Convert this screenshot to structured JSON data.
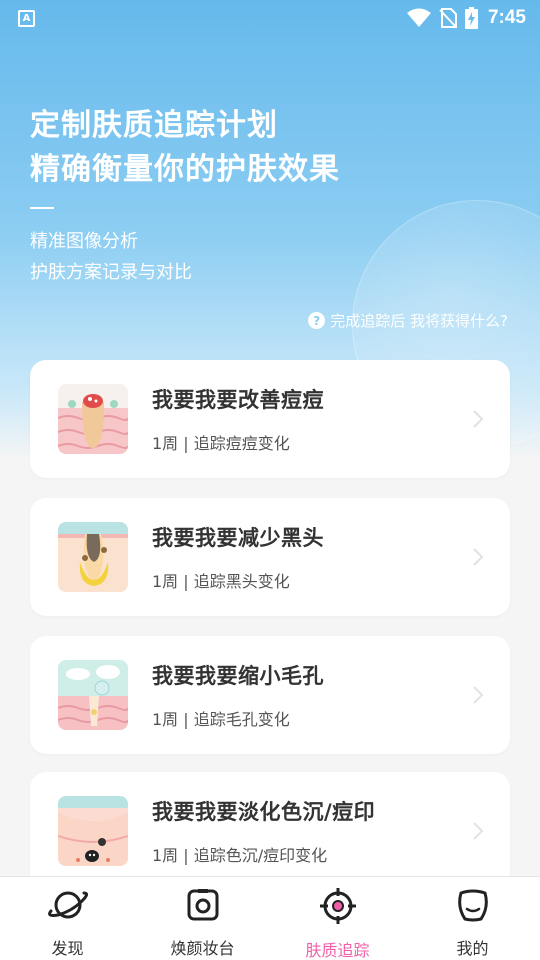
{
  "status_bar": {
    "time": "7:45",
    "app_badge": "A"
  },
  "hero": {
    "headline_line1": "定制肤质追踪计划",
    "headline_line2": "精确衡量你的护肤效果",
    "sub_line1": "精准图像分析",
    "sub_line2": "护肤方案记录与对比",
    "faq_text": "完成追踪后 我将获得什么?"
  },
  "plans": [
    {
      "title": "我要我要改善痘痘",
      "desc": "1周 | 追踪痘痘变化"
    },
    {
      "title": "我要我要减少黑头",
      "desc": "1周 | 追踪黑头变化"
    },
    {
      "title": "我要我要缩小毛孔",
      "desc": "1周 | 追踪毛孔变化"
    },
    {
      "title": "我要我要淡化色沉/痘印",
      "desc": "1周 | 追踪色沉/痘印变化"
    }
  ],
  "tabs": [
    {
      "label": "发现",
      "icon": "planet-icon"
    },
    {
      "label": "焕颜妆台",
      "icon": "camera-icon"
    },
    {
      "label": "肤质追踪",
      "icon": "target-icon",
      "active": true
    },
    {
      "label": "我的",
      "icon": "profile-icon"
    }
  ],
  "colors": {
    "active_tab": "#f25fa8",
    "hero_top": "#65b9ec"
  }
}
